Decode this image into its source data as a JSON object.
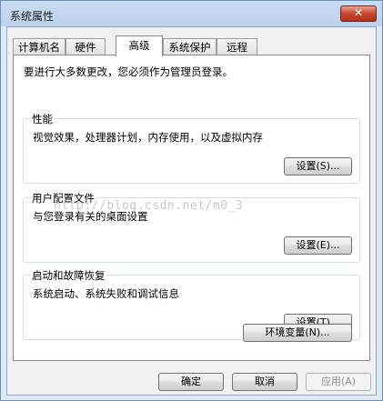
{
  "window": {
    "title": "系统属性",
    "close_label": "✕"
  },
  "tabs": [
    {
      "label": "计算机名"
    },
    {
      "label": "硬件"
    },
    {
      "label": "高级"
    },
    {
      "label": "系统保护"
    },
    {
      "label": "远程"
    }
  ],
  "advanced": {
    "notice": "要进行大多数更改，您必须作为管理员登录。",
    "performance": {
      "title": "性能",
      "desc": "视觉效果，处理器计划，内存使用，以及虚拟内存",
      "button": "设置(S)..."
    },
    "profiles": {
      "title": "用户配置文件",
      "desc": "与您登录有关的桌面设置",
      "button": "设置(E)..."
    },
    "startup": {
      "title": "启动和故障恢复",
      "desc": "系统启动、系统失败和调试信息",
      "button": "设置(T)..."
    },
    "env_button": "环境变量(N)..."
  },
  "footer": {
    "ok": "确定",
    "cancel": "取消",
    "apply": "应用(A)"
  },
  "watermark": "http://blog.csdn.net/m0_3"
}
